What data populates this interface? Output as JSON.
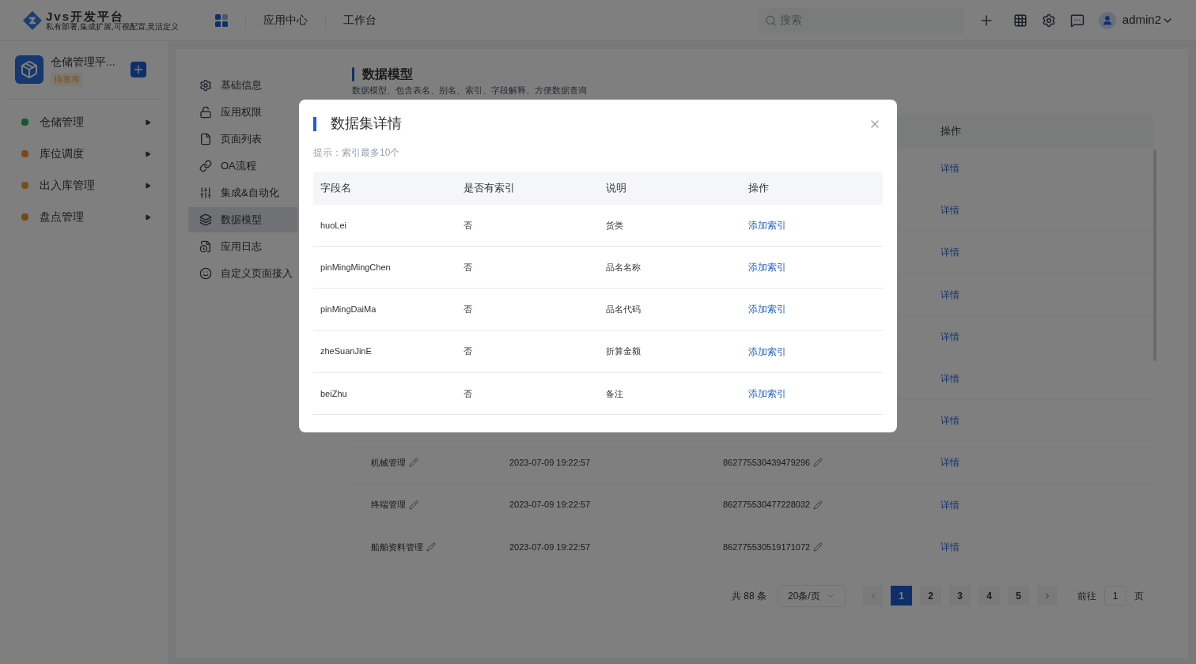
{
  "header": {
    "logo_title": "Jvs开发平台",
    "logo_slogan": "私有部署,集成扩展,可视配置,灵活定义",
    "nav": [
      {
        "label": "应用中心",
        "selected": false
      },
      {
        "label": "工作台",
        "selected": false
      }
    ],
    "search": {
      "placeholder": "搜索"
    },
    "user": "admin2"
  },
  "app": {
    "name": "仓储管理平...",
    "status": "待发布"
  },
  "menu": [
    {
      "label": "仓储管理"
    },
    {
      "label": "库位调度"
    },
    {
      "label": "出入库管理"
    },
    {
      "label": "盘点管理"
    }
  ],
  "subnav": [
    {
      "label": "基础信息",
      "selected": false
    },
    {
      "label": "应用权限",
      "selected": false
    },
    {
      "label": "页面列表",
      "selected": false
    },
    {
      "label": "OA流程",
      "selected": false
    },
    {
      "label": "集成&自动化",
      "selected": false
    },
    {
      "label": "数据模型",
      "selected": true
    },
    {
      "label": "应用日志",
      "selected": false
    },
    {
      "label": "自定义页面接入",
      "selected": false
    }
  ],
  "page": {
    "title": "数据模型",
    "subtitle": "数据模型、包含表名、别名、索引、字段解释、方便数据查询"
  },
  "table": {
    "action_header": "操作",
    "rows": [
      {
        "action": "详情"
      },
      {
        "action": "详情"
      },
      {
        "action": "详情"
      },
      {
        "action": "详情"
      },
      {
        "action": "详情"
      },
      {
        "action": "详情"
      },
      {
        "action": "详情"
      },
      {
        "name": "机械管理",
        "time": "2023-07-09 19:22:57",
        "id": "862775530439479296",
        "action": "详情"
      },
      {
        "name": "终端管理",
        "time": "2023-07-09 19:22:57",
        "id": "862775530477228032",
        "action": "详情"
      },
      {
        "name": "船舶资料管理",
        "time": "2023-07-09 19:22:57",
        "id": "862775530519171072",
        "action": "详情"
      }
    ]
  },
  "pagination": {
    "total": "共 88 条",
    "page_size": "20条/页",
    "pages": [
      {
        "label": "1",
        "selected": true
      },
      {
        "label": "2",
        "selected": false
      },
      {
        "label": "3",
        "selected": false
      },
      {
        "label": "4",
        "selected": false
      },
      {
        "label": "5",
        "selected": false
      }
    ],
    "goto_label": "前往",
    "goto_value": "1",
    "goto_suffix": "页"
  },
  "dialog": {
    "title": "数据集详情",
    "hint": "提示：索引最多10个",
    "columns": [
      "字段名",
      "是否有索引",
      "说明",
      "操作"
    ],
    "rows": [
      {
        "field": "huoLei",
        "indexed": "否",
        "description": "货类",
        "action": "添加索引"
      },
      {
        "field": "pinMingMingChen",
        "indexed": "否",
        "description": "品名名称",
        "action": "添加索引"
      },
      {
        "field": "pinMingDaiMa",
        "indexed": "否",
        "description": "品名代码",
        "action": "添加索引"
      },
      {
        "field": "zheSuanJinE",
        "indexed": "否",
        "description": "折算金额",
        "action": "添加索引"
      },
      {
        "field": "beiZhu",
        "indexed": "否",
        "description": "备注",
        "action": "添加索引"
      }
    ]
  }
}
